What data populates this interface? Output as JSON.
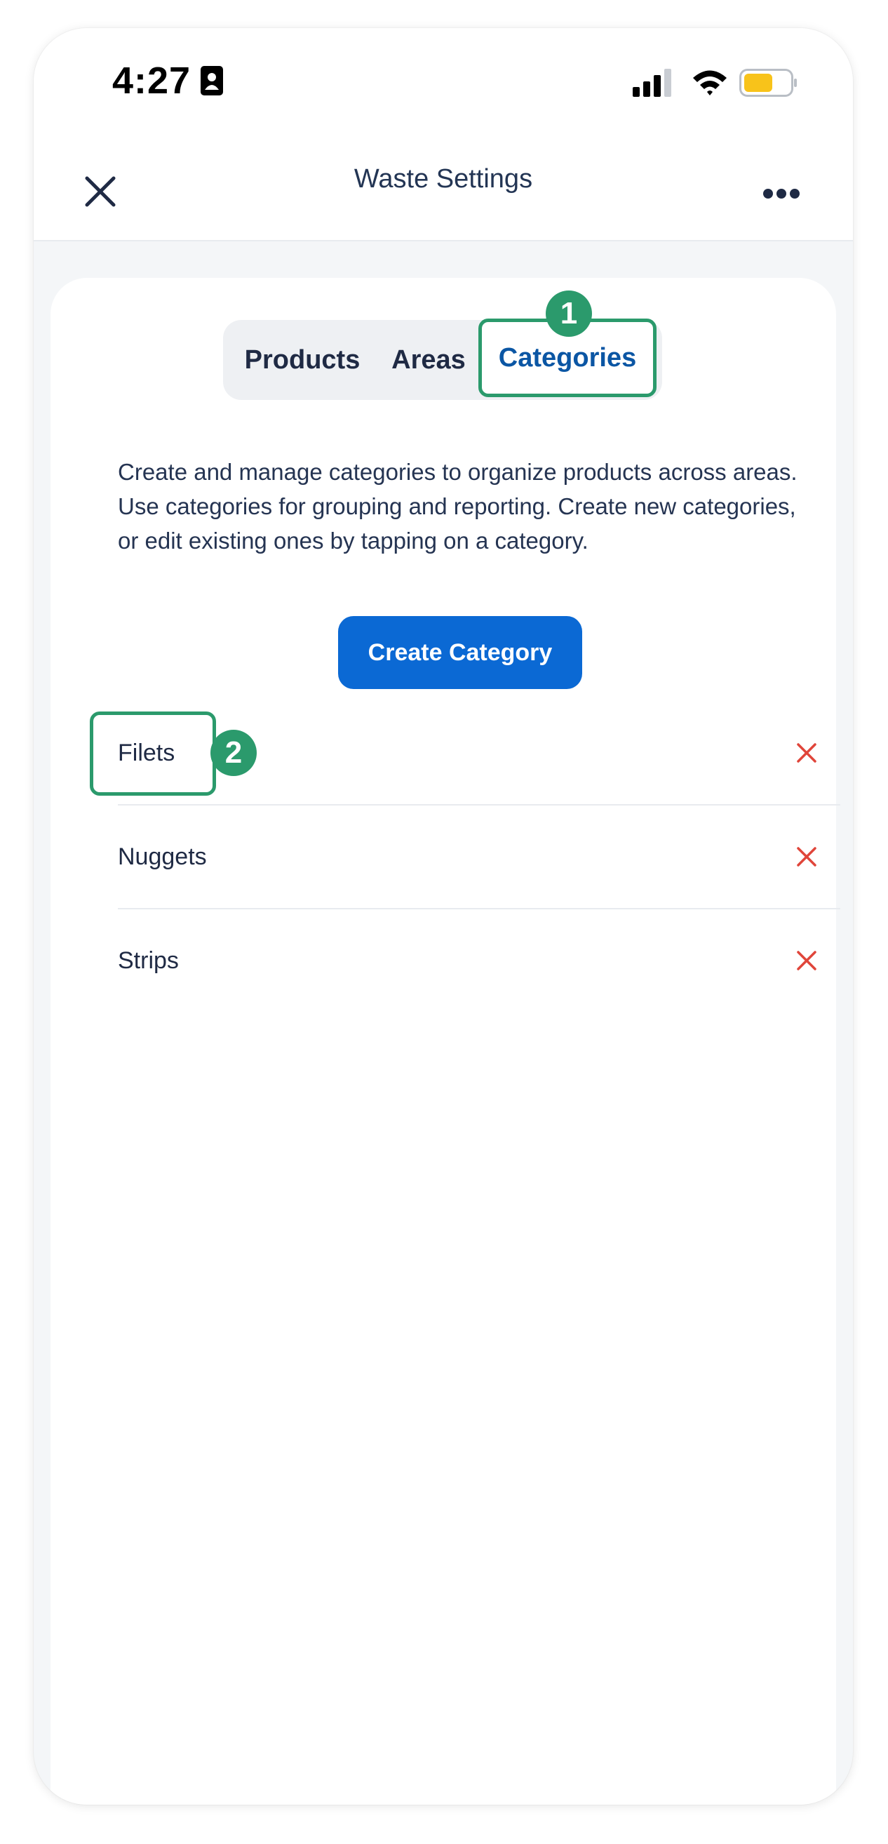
{
  "status_bar": {
    "time": "4:27",
    "battery_color": "#f8c31a"
  },
  "header": {
    "title": "Waste Settings",
    "close_icon": "close-icon",
    "more_icon": "ellipsis-icon"
  },
  "tabs": [
    {
      "label": "Products",
      "active": false
    },
    {
      "label": "Areas",
      "active": false
    },
    {
      "label": "Categories",
      "active": true
    }
  ],
  "callouts": {
    "one": "1",
    "two": "2"
  },
  "description": "Create and manage categories to organize products across areas. Use categories for grouping and reporting. Create new categories, or edit existing ones by tapping on a category.",
  "create_button_label": "Create Category",
  "categories": [
    {
      "label": "Filets"
    },
    {
      "label": "Nuggets"
    },
    {
      "label": "Strips"
    }
  ],
  "colors": {
    "accent_green": "#2b9a6c",
    "primary_blue": "#0b69d4",
    "delete_red": "#e0453a"
  }
}
